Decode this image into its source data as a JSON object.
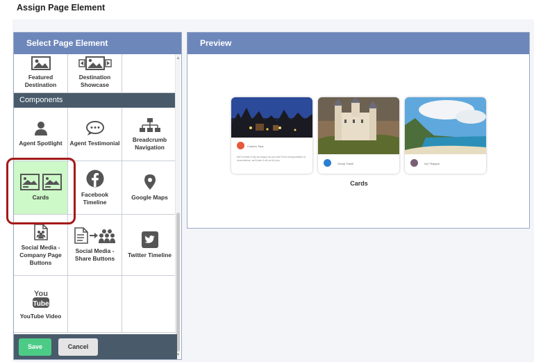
{
  "page_title": "Assign Page Element",
  "left_panel": {
    "title": "Select Page Element",
    "top_items": [
      {
        "label": "Featured Destination",
        "icon": "image-icon"
      },
      {
        "label": "Destination Showcase",
        "icon": "image-carousel-icon"
      }
    ],
    "section_label": "Components",
    "items": [
      {
        "label": "Agent Spotlight",
        "icon": "person-icon"
      },
      {
        "label": "Agent Testimonial",
        "icon": "speech-bubble-icon"
      },
      {
        "label": "Breadcrumb Navigation",
        "icon": "sitemap-icon"
      },
      {
        "label": "Cards",
        "icon": "cards-icon",
        "selected": true
      },
      {
        "label": "Facebook Timeline",
        "icon": "facebook-icon"
      },
      {
        "label": "Google Maps",
        "icon": "map-pin-icon"
      },
      {
        "label": "Social Media - Company Page Buttons",
        "icon": "document-people-icon"
      },
      {
        "label": "Social Media - Share Buttons",
        "icon": "share-people-icon"
      },
      {
        "label": "Twitter Timeline",
        "icon": "twitter-icon"
      },
      {
        "label": "YouTube Video",
        "icon": "youtube-icon"
      }
    ],
    "save_label": "Save",
    "cancel_label": "Cancel"
  },
  "preview": {
    "title": "Preview",
    "caption": "Cards",
    "cards": [
      {
        "name": "Custom Trips",
        "text": "We'll create a trip as unique as you are! From transportation to reservations, we'll plan it all out for you."
      },
      {
        "name": "Group Travel",
        "text": ""
      },
      {
        "name": "Ivy? Rappon",
        "text": ""
      }
    ]
  },
  "colors": {
    "panel_header": "#6e87bb",
    "section_header": "#495b6b",
    "selected_bg": "#cdf8c8",
    "highlight_ring": "#a51818",
    "save": "#4ccb87",
    "cancel": "#e4e4e4"
  }
}
